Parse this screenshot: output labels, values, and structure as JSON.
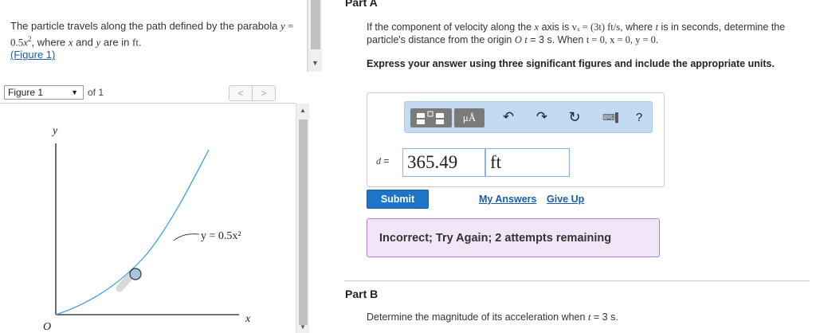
{
  "problem": {
    "text_1": "The particle travels along the path defined by the parabola ",
    "eq_y": "y",
    "eq_eq": " = 0.5",
    "eq_x": "x",
    "eq_exp": "2",
    "text_2": ", where ",
    "var_x": "x",
    "text_and": " and ",
    "var_y": "y",
    "text_3": " are in ",
    "unit_ft": "ft",
    "text_4": ".",
    "figure_link": "(Figure 1)"
  },
  "figure_pane": {
    "select_value": "Figure 1",
    "of_label": "of 1",
    "prev_label": "<",
    "next_label": ">",
    "axis_y": "y",
    "axis_x": "x",
    "origin": "O",
    "curve_label": "y = 0.5x²"
  },
  "part_a": {
    "title": "Part A",
    "q_1": "If the component of velocity along the ",
    "q_x": "x",
    "q_2": " axis is ",
    "q_vx": "vₓ = (3t) ft/s",
    "q_3": ", where ",
    "q_t": "t",
    "q_4": " is in seconds, determine the particle's distance from the origin ",
    "q_O": "O",
    "q_5": " ",
    "q_t2": "t",
    "q_6": " = 3 s. When ",
    "q_cond": "t = 0, x = 0, y = 0.",
    "instructions": "Express your answer using three significant figures and include the appropriate units."
  },
  "answer": {
    "label": "d =",
    "value": "365.49",
    "unit": "ft",
    "units_button": "μÅ",
    "undo_icon": "undo-icon",
    "redo_icon": "redo-icon",
    "reset_icon": "reset-icon",
    "keyboard_icon": "keyboard-icon",
    "help_label": "?"
  },
  "actions": {
    "submit": "Submit",
    "my_answers": "My Answers",
    "give_up": "Give Up"
  },
  "feedback": {
    "message": "Incorrect; Try Again; 2 attempts remaining",
    "bg_color": "#f1e6f7",
    "border_color": "#b27fcf"
  },
  "part_b": {
    "title": "Part B",
    "q_1": "Determine the magnitude of its acceleration when ",
    "q_t": "t",
    "q_2": " = 3 s."
  },
  "colors": {
    "accent": "#1e74c6",
    "link": "#1a5ea8",
    "curve": "#3da0e0",
    "toolbar": "#c4daf2"
  }
}
